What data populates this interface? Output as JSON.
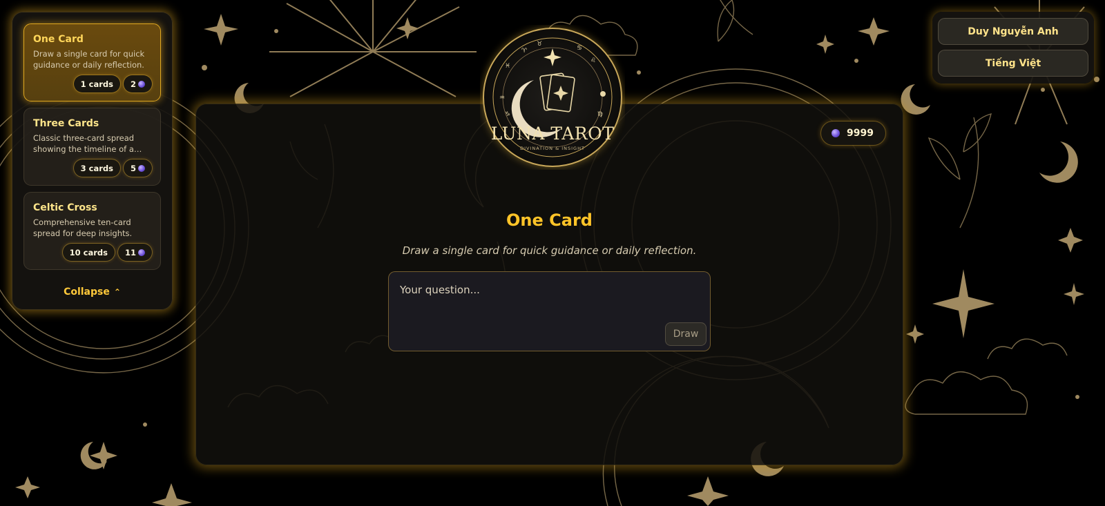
{
  "sidebar": {
    "spreads": [
      {
        "title": "One Card",
        "description": "Draw a single card for quick guidance or daily reflection.",
        "cards_label": "1 cards",
        "cost": "2",
        "active": true
      },
      {
        "title": "Three Cards",
        "description": "Classic three-card spread showing the timeline of a…",
        "cards_label": "3 cards",
        "cost": "5",
        "active": false
      },
      {
        "title": "Celtic Cross",
        "description": "Comprehensive ten-card spread for deep insights.",
        "cards_label": "10 cards",
        "cost": "11",
        "active": false
      }
    ],
    "collapse_label": "Collapse"
  },
  "user": {
    "name": "Duy Nguyễn Anh",
    "language": "Tiếng Việt"
  },
  "logo": {
    "name": "LUNA TAROT",
    "tagline": "DIVINATION & INSIGHT"
  },
  "main": {
    "credits": "9999",
    "title": "One Card",
    "subtitle": "Draw a single card for quick guidance or daily reflection.",
    "question_placeholder": "Your question...",
    "draw_label": "Draw"
  },
  "colors": {
    "accent": "#ffc428",
    "gold_line": "#a08a60",
    "background": "#000000"
  }
}
